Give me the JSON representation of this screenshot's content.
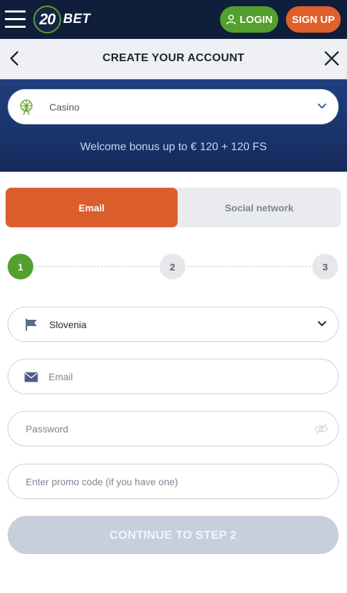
{
  "topbar": {
    "logo_number": "20",
    "logo_text": "BET",
    "login_label": "LOGIN",
    "signup_label": "SIGN UP"
  },
  "header": {
    "title": "CREATE YOUR ACCOUNT"
  },
  "bonus": {
    "selected": "Casino",
    "welcome_text": "Welcome bonus up to € 120 + 120 FS"
  },
  "tabs": [
    {
      "label": "Email",
      "active": true
    },
    {
      "label": "Social network",
      "active": false
    }
  ],
  "steps": [
    {
      "number": "1",
      "active": true
    },
    {
      "number": "2",
      "active": false
    },
    {
      "number": "3",
      "active": false
    }
  ],
  "form": {
    "country_value": "Slovenia",
    "email_placeholder": "Email",
    "password_placeholder": "Password",
    "promo_placeholder": "Enter promo code (if you have one)"
  },
  "continue_label": "CONTINUE TO STEP 2",
  "icons": {
    "menu": "hamburger-menu-icon",
    "login": "user-icon",
    "back": "chevron-left-icon",
    "close": "close-icon",
    "bonus": "ferris-wheel-icon",
    "country": "flag-icon",
    "email": "envelope-icon",
    "password": "eye-off-icon",
    "dropdown": "chevron-down-icon"
  },
  "colors": {
    "navy": "#0f1e3a",
    "green": "#53a02e",
    "orange": "#e0602b",
    "banner_blue": "#1f3e7c",
    "disabled_button": "#c7cfdd"
  }
}
